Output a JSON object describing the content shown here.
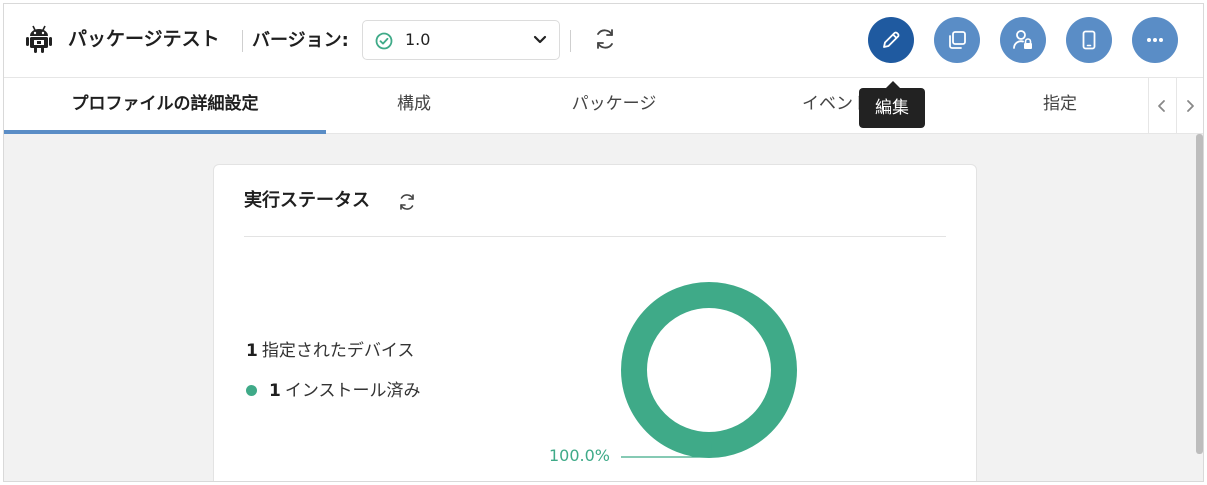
{
  "header": {
    "title": "パッケージテスト",
    "version_label": "バージョン:",
    "version_value": "1.0",
    "buttons": [
      "edit-icon",
      "copy-icon",
      "user-lock-icon",
      "device-icon",
      "more-icon"
    ]
  },
  "tooltip": {
    "text": "編集"
  },
  "tabs": [
    {
      "label": "プロファイルの詳細設定",
      "active": true
    },
    {
      "label": "構成"
    },
    {
      "label": "パッケージ"
    },
    {
      "label": "イベント"
    },
    {
      "label": "指定"
    }
  ],
  "card": {
    "title": "実行ステータス",
    "assigned_count": "1",
    "assigned_label": "指定されたデバイス",
    "installed_count": "1",
    "installed_label": "インストール済み",
    "percent_label": "100.0%"
  },
  "colors": {
    "accent": "#5a8dc6",
    "accent_active": "#1f5aa0",
    "installed": "#3faa88"
  },
  "chart_data": {
    "type": "pie",
    "categories": [
      "インストール済み"
    ],
    "values": [
      100.0
    ],
    "colors": [
      "#3faa88"
    ]
  }
}
